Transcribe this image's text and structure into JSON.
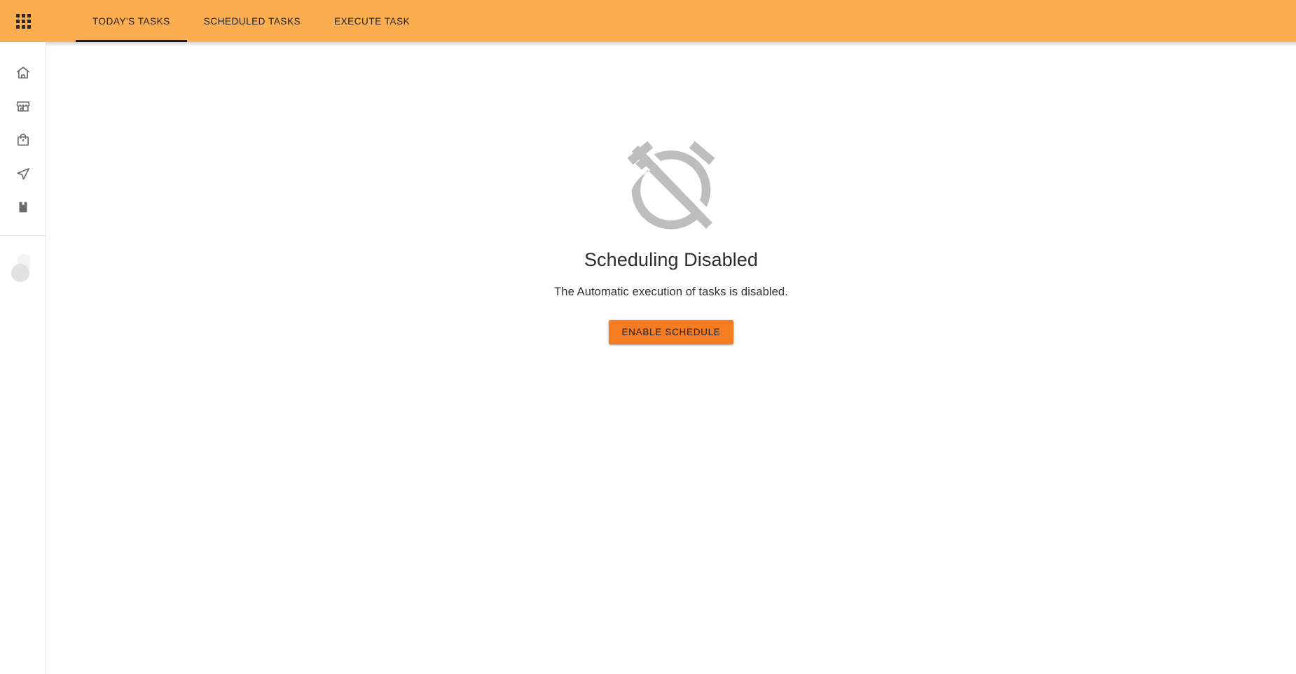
{
  "theme": {
    "appbar_color": "#FBAD4F",
    "button_color": "#F57C20",
    "text_color": "#1f1e1c",
    "muted_icon_color": "#bdbdbd",
    "sidebar_icon_color": "#6b6b6b"
  },
  "appbar": {
    "apps_button_label": "Apps",
    "tabs": [
      {
        "label": "TODAY'S TASKS",
        "active": true
      },
      {
        "label": "SCHEDULED TASKS",
        "active": false
      },
      {
        "label": "EXECUTE TASK",
        "active": false
      }
    ]
  },
  "sidebar": {
    "items": [
      {
        "icon": "home-icon",
        "label": "Home"
      },
      {
        "icon": "storefront-icon",
        "label": "Store"
      },
      {
        "icon": "shopping-bag-icon",
        "label": "Orders"
      },
      {
        "icon": "navigation-send-icon",
        "label": "Deliveries"
      },
      {
        "icon": "bookmark-book-icon",
        "label": "Catalog"
      }
    ],
    "avatar": {
      "icon": "avatar-placeholder-icon",
      "label": "Account"
    }
  },
  "main": {
    "empty_state": {
      "icon": "alarm-off-icon",
      "title": "Scheduling Disabled",
      "subtitle": "The Automatic execution of tasks is disabled.",
      "action_label": "ENABLE SCHEDULE"
    }
  }
}
